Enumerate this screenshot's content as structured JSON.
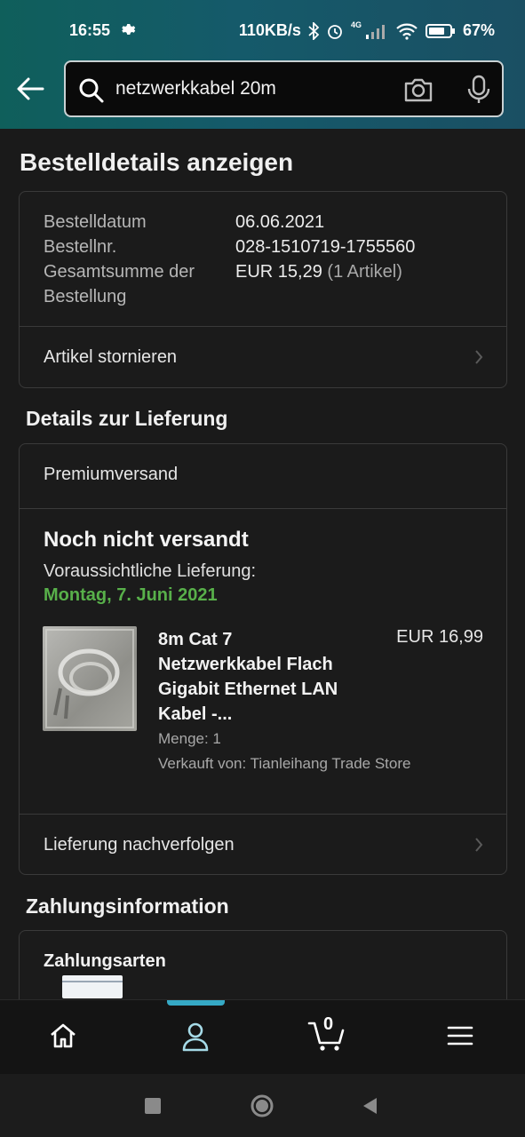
{
  "status_bar": {
    "time": "16:55",
    "network_speed": "110KB/s",
    "network_type": "4G",
    "battery": "67%"
  },
  "search": {
    "query": "netzwerkkabel 20m"
  },
  "page": {
    "title": "Bestelldetails anzeigen"
  },
  "order_summary": {
    "date_label": "Bestelldatum",
    "date_value": "06.06.2021",
    "number_label": "Bestellnr.",
    "number_value": "028-1510719-1755560",
    "total_label_line1": "Gesamtsumme der",
    "total_label_line2": "Bestellung",
    "total_value": "EUR 15,29",
    "total_items": "(1 Artikel)",
    "cancel_label": "Artikel stornieren"
  },
  "delivery": {
    "section_title": "Details zur Lieferung",
    "shipping_method": "Premiumversand",
    "status": "Noch nicht versandt",
    "expected_label": "Voraussichtliche Lieferung:",
    "expected_date": "Montag, 7. Juni 2021",
    "accent_color": "#58b04a",
    "item": {
      "title_line1": "8m Cat 7",
      "title_line2": "Netzwerkkabel Flach",
      "title_line3": "Gigabit Ethernet LAN",
      "title_line4": "Kabel -...",
      "price": "EUR 16,99",
      "quantity": "Menge: 1",
      "seller": "Verkauft von: Tianleihang Trade Store"
    },
    "track_label": "Lieferung nachverfolgen"
  },
  "payment": {
    "section_title": "Zahlungsinformation",
    "methods_label": "Zahlungsarten"
  },
  "bottom_nav": {
    "cart_count": "0",
    "active_tab": "account",
    "indicator_color": "#35a9c5"
  }
}
